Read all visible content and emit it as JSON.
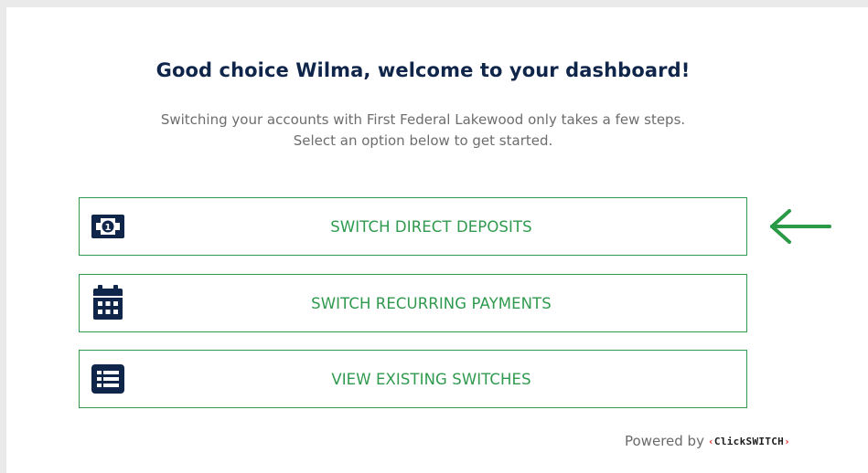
{
  "header": {
    "title": "Good choice Wilma, welcome to your dashboard!",
    "subtitle_line1": "Switching your accounts with First Federal Lakewood only takes a few steps.",
    "subtitle_line2": "Select an option below to get started."
  },
  "options": [
    {
      "label": "SWITCH DIRECT DEPOSITS",
      "icon": "money-bill-icon"
    },
    {
      "label": "SWITCH RECURRING PAYMENTS",
      "icon": "calendar-icon"
    },
    {
      "label": "VIEW EXISTING SWITCHES",
      "icon": "list-icon"
    }
  ],
  "footer": {
    "powered_by": "Powered by",
    "brand_open": "‹",
    "brand_name": "ClickSWITCH",
    "brand_close": "›"
  },
  "colors": {
    "title": "#10254a",
    "subtitle": "#6d6d6d",
    "accent_green": "#2f9a4e",
    "icon_navy": "#10254a",
    "brand_red": "#e0292b"
  }
}
